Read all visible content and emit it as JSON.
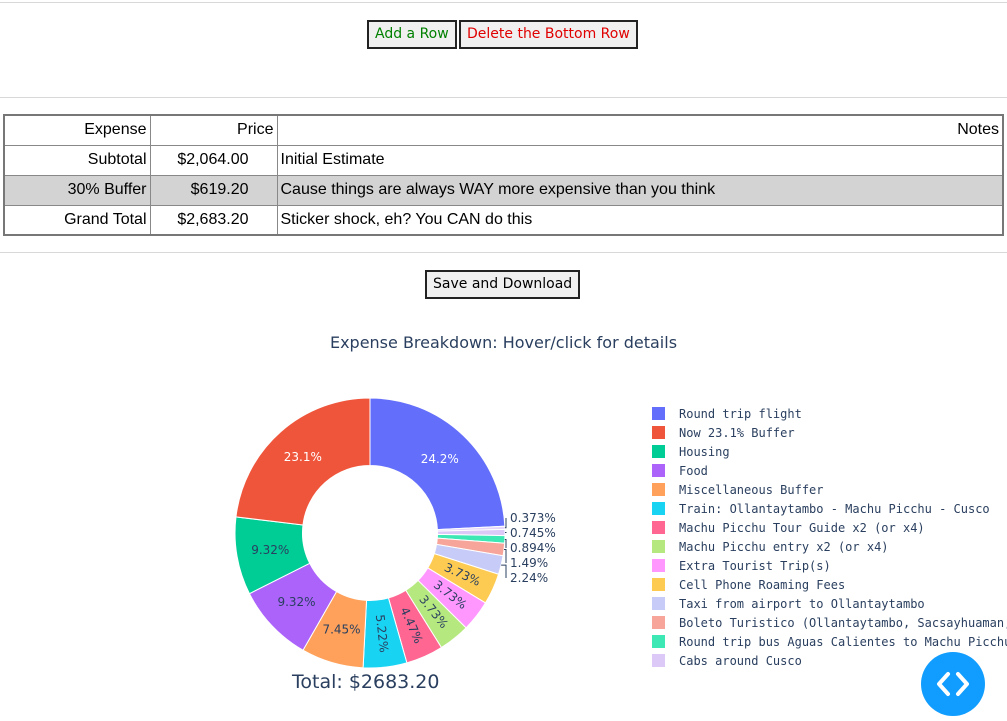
{
  "toolbar": {
    "add_row_label": "Add a Row",
    "delete_row_label": "Delete the Bottom Row",
    "add_color": "#008000",
    "delete_color": "#e00000"
  },
  "table": {
    "headers": [
      "Expense",
      "Price",
      "Notes"
    ],
    "rows": [
      {
        "expense": "Subtotal",
        "price": "$2,064.00",
        "notes": "Initial Estimate"
      },
      {
        "expense": "30% Buffer",
        "price": "$619.20",
        "notes": "Cause things are always WAY more expensive than you think"
      },
      {
        "expense": "Grand Total",
        "price": "$2,683.20",
        "notes": "Sticker shock, eh? You CAN do this"
      }
    ]
  },
  "save_label": "Save and Download",
  "total_text": "Total: $2683.20",
  "chart_data": {
    "type": "pie",
    "title": "Expense Breakdown:  Hover/click for details",
    "hole": 0.5,
    "labels": [
      "Round trip flight",
      "Now 23.1% Buffer",
      "Housing",
      "Food",
      "Miscellaneous Buffer",
      "Train: Ollantaytambo - Machu Picchu - Cusco",
      "Machu Picchu Tour Guide x2 (or x4)",
      "Machu Picchu entry x2 (or x4)",
      "Extra Tourist Trip(s)",
      "Cell Phone Roaming Fees",
      "Taxi from airport to Ollantaytambo",
      "Boleto Turistico (Ollantaytambo, Sacsayhuaman, etc.)",
      "Round trip bus Aguas Calientes to Machu Picchu",
      "Cabs around Cusco"
    ],
    "percent_labels": [
      "24.2%",
      "23.1%",
      "9.32%",
      "9.32%",
      "7.45%",
      "5.22%",
      "4.47%",
      "3.73%",
      "3.73%",
      "3.73%",
      "2.24%",
      "1.49%",
      "0.894%",
      "0.745%",
      "0.373%"
    ],
    "slices": [
      {
        "name": "Round trip flight",
        "percent": 24.2,
        "label": "24.2%",
        "color": "#636efa"
      },
      {
        "name": "0.373%",
        "percent": 0.373,
        "label": "0.373%",
        "color": "#e6d7fa"
      },
      {
        "name": "Cabs around Cusco",
        "percent": 0.745,
        "label": "0.745%",
        "color": "#dcc9f8"
      },
      {
        "name": "Round trip bus Aguas Calientes to Machu Picchu",
        "percent": 0.894,
        "label": "0.894%",
        "color": "#3de8b5"
      },
      {
        "name": "Boleto Turistico (Ollantaytambo, Sacsayhuaman, etc.)",
        "percent": 1.49,
        "label": "1.49%",
        "color": "#f7a59a"
      },
      {
        "name": "Taxi from airport to Ollantaytambo",
        "percent": 2.24,
        "label": "2.24%",
        "color": "#c6cbf7"
      },
      {
        "name": "Cell Phone Roaming Fees",
        "percent": 3.73,
        "label": "3.73%",
        "color": "#fecb52"
      },
      {
        "name": "Extra Tourist Trip(s)",
        "percent": 3.73,
        "label": "3.73%",
        "color": "#ff97ff"
      },
      {
        "name": "Machu Picchu entry x2 (or x4)",
        "percent": 3.73,
        "label": "3.73%",
        "color": "#b6e880"
      },
      {
        "name": "Machu Picchu Tour Guide x2 (or x4)",
        "percent": 4.47,
        "label": "4.47%",
        "color": "#ff6692"
      },
      {
        "name": "Train: Ollantaytambo - Machu Picchu - Cusco",
        "percent": 5.22,
        "label": "5.22%",
        "color": "#19d3f3"
      },
      {
        "name": "Miscellaneous Buffer",
        "percent": 7.45,
        "label": "7.45%",
        "color": "#ffa15a"
      },
      {
        "name": "Food",
        "percent": 9.32,
        "label": "9.32%",
        "color": "#ab63fa"
      },
      {
        "name": "Housing",
        "percent": 9.32,
        "label": "9.32%",
        "color": "#00cc96"
      },
      {
        "name": "Now 23.1% Buffer",
        "percent": 23.1,
        "label": "23.1%",
        "color": "#ef553b"
      }
    ],
    "legend": [
      {
        "name": "Round trip flight",
        "color": "#636efa"
      },
      {
        "name": "Now 23.1% Buffer",
        "color": "#ef553b"
      },
      {
        "name": "Housing",
        "color": "#00cc96"
      },
      {
        "name": "Food",
        "color": "#ab63fa"
      },
      {
        "name": "Miscellaneous Buffer",
        "color": "#ffa15a"
      },
      {
        "name": "Train: Ollantaytambo - Machu Picchu - Cusco",
        "color": "#19d3f3"
      },
      {
        "name": "Machu Picchu Tour Guide x2 (or x4)",
        "color": "#ff6692"
      },
      {
        "name": "Machu Picchu entry x2 (or x4)",
        "color": "#b6e880"
      },
      {
        "name": "Extra Tourist Trip(s)",
        "color": "#ff97ff"
      },
      {
        "name": "Cell Phone Roaming Fees",
        "color": "#fecb52"
      },
      {
        "name": "Taxi from airport to Ollantaytambo",
        "color": "#c6cbf7"
      },
      {
        "name": "Boleto Turistico (Ollantaytambo, Sacsayhuaman, etc.)",
        "color": "#f7a59a"
      },
      {
        "name": "Round trip bus Aguas Calientes to Machu Picchu",
        "color": "#3de8b5"
      },
      {
        "name": "Cabs around Cusco",
        "color": "#dcc9f8"
      }
    ]
  },
  "fab": {
    "icon": "code-icon",
    "color": "#119dff"
  }
}
